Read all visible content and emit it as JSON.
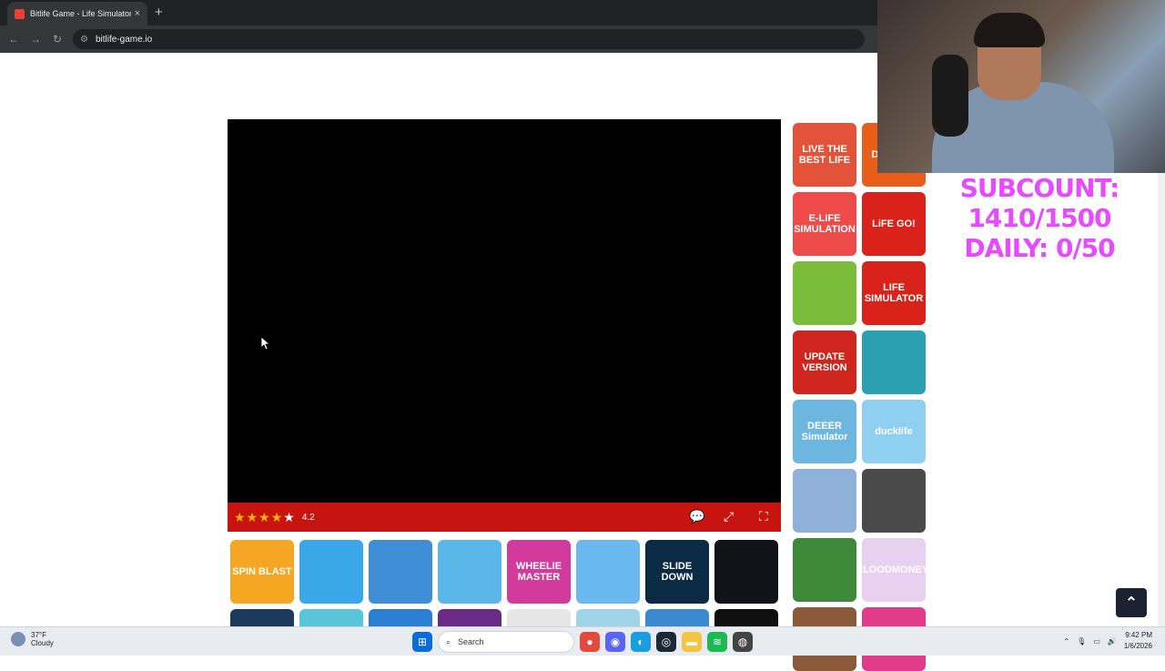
{
  "browser": {
    "tab_title": "Bitlife Game - Life Simulator",
    "tab_close": "×",
    "new_tab": "+",
    "back": "←",
    "forward": "→",
    "reload": "↻",
    "url": "bitlife-game.io",
    "tune_icon": "⚙"
  },
  "game": {
    "rating": "4.2",
    "stars": 5,
    "comment_icon": "💬",
    "expand_icon": "⤢",
    "fullscreen_icon": "⛶"
  },
  "thumbnails_bottom": [
    {
      "label": "SPIN BLAST",
      "color": "#f5a623"
    },
    {
      "label": "",
      "color": "#3aa7e8"
    },
    {
      "label": "",
      "color": "#3f8fd6"
    },
    {
      "label": "",
      "color": "#5bb7e8"
    },
    {
      "label": "WHEELIE MASTER",
      "color": "#d23b9c"
    },
    {
      "label": "",
      "color": "#69b8f0"
    },
    {
      "label": "SLIDE DOWN",
      "color": "#0b2b44"
    },
    {
      "label": "",
      "color": "#101418"
    }
  ],
  "thumbnails_bottom_row2": [
    "#1c3a5e",
    "#58c6d8",
    "#2a7ed4",
    "#6a2a86",
    "#e6e6e6",
    "#9fd3e8",
    "#3a8ad2",
    "#0f0f0f"
  ],
  "sidebar_col1": [
    {
      "label": "LIVE THE BEST LIFE",
      "color": "#e2533a"
    },
    {
      "label": "E-LIFE SIMULATION",
      "color": "#f04b4b"
    },
    {
      "label": "",
      "color": "#7bbd3a"
    },
    {
      "label": "UPDATE VERSION",
      "color": "#d0251c"
    },
    {
      "label": "DEEER Simulator",
      "color": "#6cb6e0"
    },
    {
      "label": "",
      "color": "#8fb0d8"
    },
    {
      "label": "",
      "color": "#3e8a3a"
    },
    {
      "label": "",
      "color": "#8a5a3a"
    }
  ],
  "sidebar_col2": [
    {
      "label": "DOGLIFE",
      "color": "#e85d1a"
    },
    {
      "label": "LiFE GO!",
      "color": "#d8221a"
    },
    {
      "label": "LIFE SIMULATOR",
      "color": "#d8221a"
    },
    {
      "label": "",
      "color": "#2aa0b0"
    },
    {
      "label": "ducklife",
      "color": "#8fd0f0"
    },
    {
      "label": "",
      "color": "#4a4a4a"
    },
    {
      "label": "BLOODMONEY!",
      "color": "#e8d0f0"
    },
    {
      "label": "",
      "color": "#e23b8a"
    }
  ],
  "scroll_top_icon": "⌃",
  "stream_overlay": {
    "line1": "SUBCOUNT: 1410/1500",
    "line2": "DAILY: 0/50"
  },
  "taskbar": {
    "temperature": "37°F",
    "condition": "Cloudy",
    "search_label": "Search",
    "time": "9:42 PM",
    "date": "1/6/2026"
  }
}
